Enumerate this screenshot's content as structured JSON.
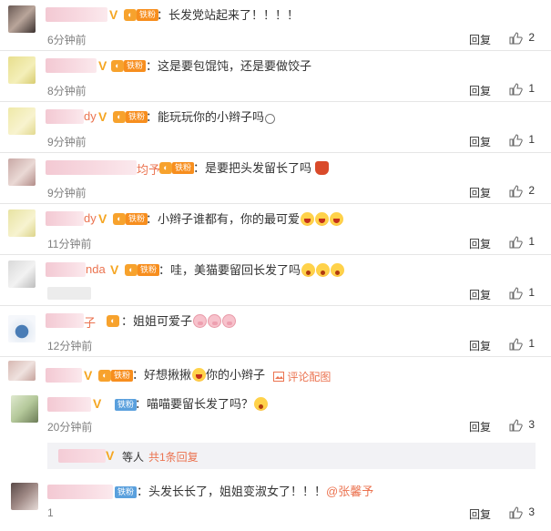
{
  "comments": [
    {
      "name_tail": "",
      "fan_label": "铁粉",
      "text": "：长发党站起来了！！！！",
      "time": "6分钟前",
      "reply_label": "回复",
      "likes": "2"
    },
    {
      "name_tail": "",
      "fan_label": "铁粉",
      "text": "：这是要包馄饨，还是要做饺子",
      "time": "8分钟前",
      "reply_label": "回复",
      "likes": "1"
    },
    {
      "name_tail": "dy",
      "fan_label": "铁粉",
      "text": "：能玩玩你的小辫子吗",
      "time": "9分钟前",
      "reply_label": "回复",
      "likes": "1"
    },
    {
      "name_tail": "均予",
      "fan_label": "铁粉",
      "text": "：是要把头发留长了吗",
      "time": "9分钟前",
      "reply_label": "回复",
      "likes": "2"
    },
    {
      "name_tail": "dy",
      "fan_label": "铁粉",
      "text": "：小辫子谁都有，你的最可爱",
      "time": "11分钟前",
      "reply_label": "回复",
      "likes": "1"
    },
    {
      "name_tail": "nda",
      "fan_label": "铁粉",
      "text": "：哇，美猫要留回长发了吗",
      "time": "",
      "reply_label": "回复",
      "likes": "1"
    },
    {
      "name_tail": "子",
      "fan_label": "",
      "text": "：姐姐可爱子",
      "time": "12分钟前",
      "reply_label": "回复",
      "likes": "1"
    },
    {
      "name_tail": "",
      "fan_label": "铁粉",
      "text": "：好想揪揪",
      "text2": "你的小辫子",
      "link": "评论配图",
      "time": "",
      "reply_label": "",
      "likes": ""
    },
    {
      "name_tail": "",
      "fan_label": "铁粉",
      "text": "：喵喵要留长发了吗？",
      "time": "20分钟前",
      "reply_label": "回复",
      "likes": "3"
    },
    {
      "name_tail": "",
      "fan_label": "铁粉",
      "text": "：头发长长了，姐姐变淑女了！！！",
      "at": "@张馨予",
      "time": "1",
      "reply_label": "回复",
      "likes": "3"
    }
  ],
  "sub_reply": {
    "text": "等人",
    "link": "共1条回复"
  },
  "colors": {
    "accent": "#eb7350",
    "vip": "#f5a623",
    "fan": "#f78e1e",
    "fan_blue": "#5aa0dd"
  }
}
